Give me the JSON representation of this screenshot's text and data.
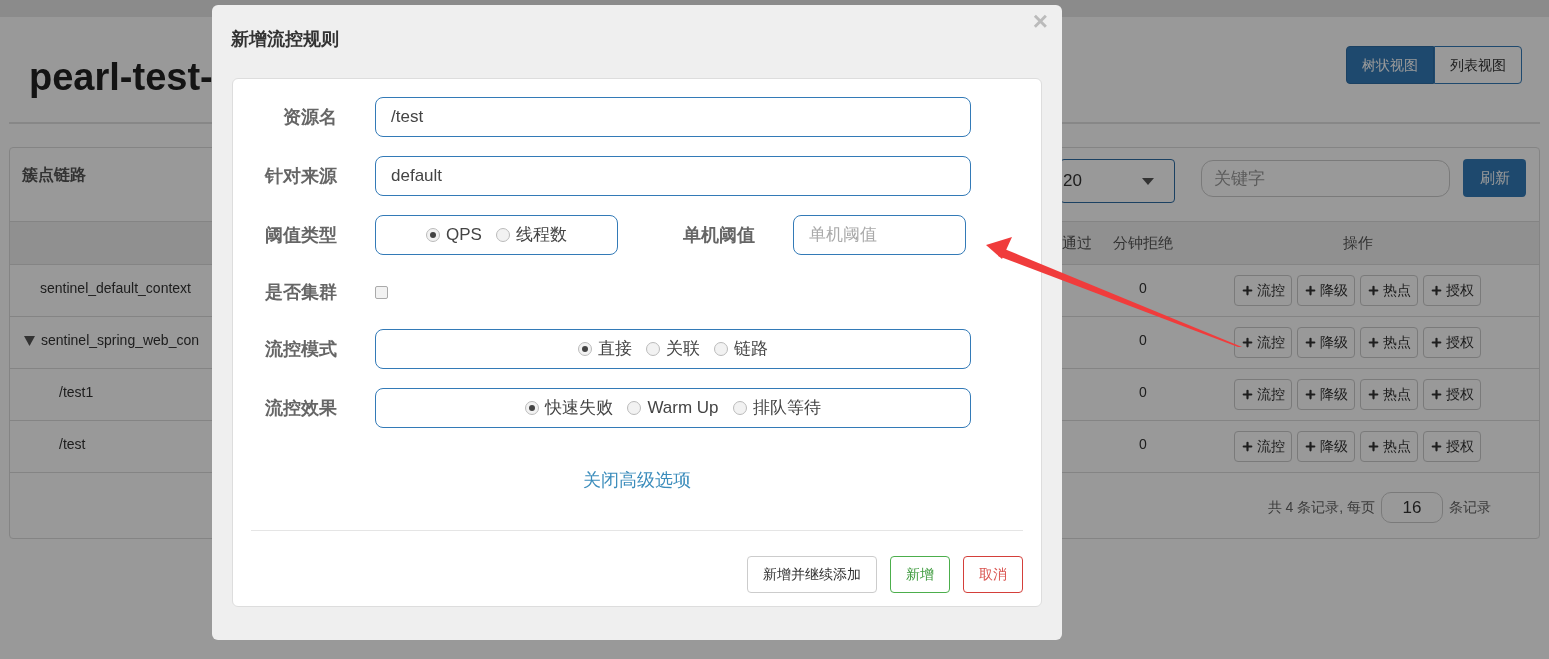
{
  "page": {
    "title": "pearl-test-",
    "view_toggle": [
      {
        "label": "树状视图",
        "selected": true
      },
      {
        "label": "列表视图",
        "selected": false
      }
    ]
  },
  "panel": {
    "title": "簇点链路",
    "page_size_select": {
      "value": "20"
    },
    "search": {
      "placeholder": "关键字"
    },
    "refresh_button": "刷新",
    "table": {
      "columns": [
        "通过",
        "分钟拒绝",
        "操作"
      ],
      "rows": [
        {
          "name": "sentinel_default_context",
          "rejected": "0",
          "actions": [
            "流控",
            "降级",
            "热点",
            "授权"
          ]
        },
        {
          "name": "sentinel_spring_web_con",
          "expanded": true,
          "rejected": "0",
          "actions": [
            "流控",
            "降级",
            "热点",
            "授权"
          ],
          "children": [
            {
              "name": "/test1",
              "rejected": "0",
              "actions": [
                "流控",
                "降级",
                "热点",
                "授权"
              ]
            },
            {
              "name": "/test",
              "rejected": "0",
              "actions": [
                "流控",
                "降级",
                "热点",
                "授权"
              ]
            }
          ]
        }
      ]
    },
    "pagination": {
      "summary": "共 4 条记录, 每页",
      "page_size": "16",
      "suffix": "条记录"
    }
  },
  "dialog": {
    "title": "新增流控规则",
    "close": "×",
    "fields": [
      {
        "kind": "text",
        "label": "资源名",
        "value": "/test"
      },
      {
        "kind": "text",
        "label": "针对来源",
        "value": "default"
      },
      {
        "kind": "radio",
        "label": "阈值类型",
        "options": [
          {
            "label": "QPS",
            "selected": true
          },
          {
            "label": "线程数",
            "selected": false
          }
        ],
        "side_field": {
          "label": "单机阈值",
          "placeholder": "单机阈值"
        }
      },
      {
        "kind": "checkbox",
        "label": "是否集群",
        "checked": false
      },
      {
        "kind": "radio",
        "label": "流控模式",
        "options": [
          {
            "label": "直接",
            "selected": true
          },
          {
            "label": "关联",
            "selected": false
          },
          {
            "label": "链路",
            "selected": false
          }
        ]
      },
      {
        "kind": "radio",
        "label": "流控效果",
        "options": [
          {
            "label": "快速失败",
            "selected": true
          },
          {
            "label": "Warm Up",
            "selected": false
          },
          {
            "label": "排队等待",
            "selected": false
          }
        ]
      }
    ],
    "advanced_link": "关闭高级选项",
    "buttons": [
      {
        "label": "新增并继续添加",
        "kind": "default"
      },
      {
        "label": "新增",
        "kind": "success"
      },
      {
        "label": "取消",
        "kind": "danger"
      }
    ]
  }
}
